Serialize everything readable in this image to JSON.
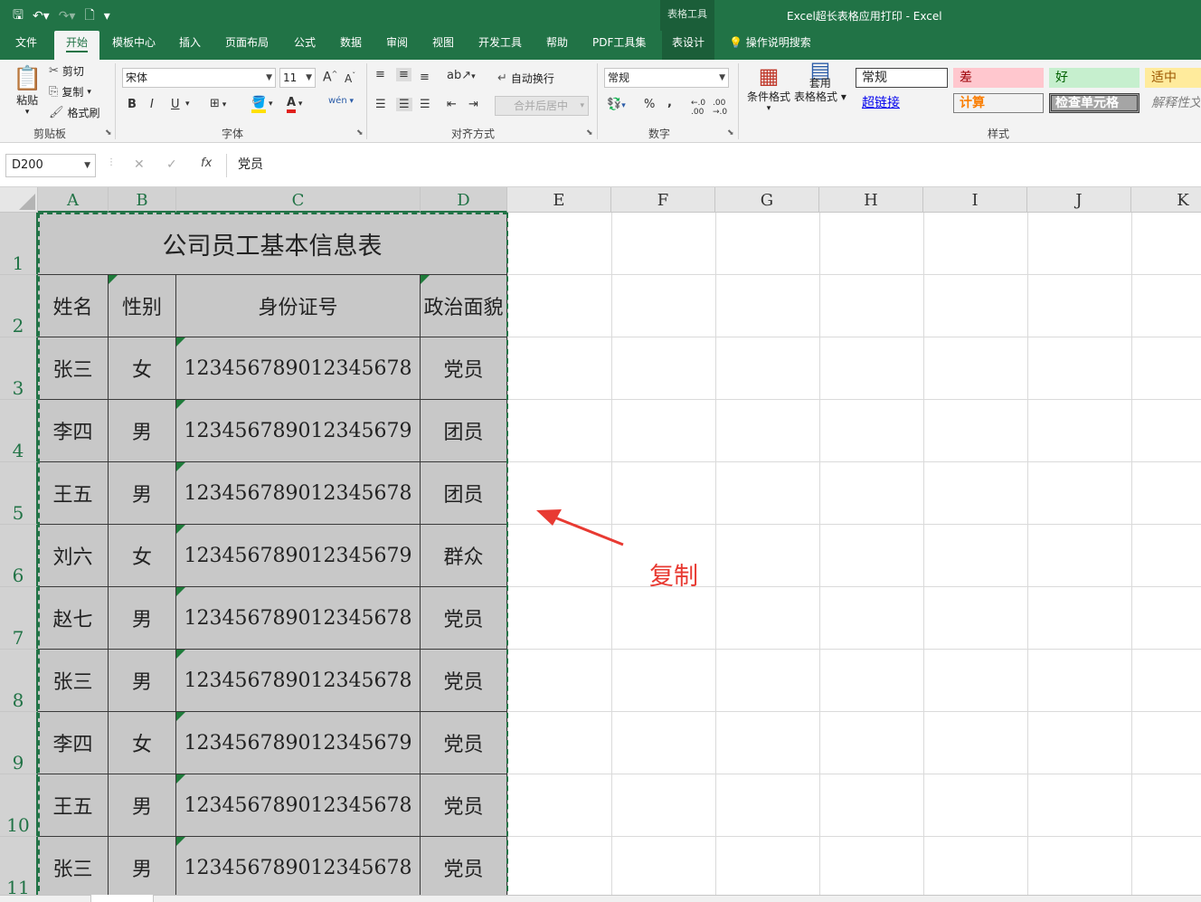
{
  "titlebar": {
    "window_title": "Excel超长表格应用打印  -  Excel",
    "context_group": "表格工具",
    "qat": {
      "save_icon": "save-icon",
      "undo_icon": "undo-icon",
      "redo_icon": "redo-icon",
      "preview_icon": "print-preview-icon",
      "customize": "▾"
    }
  },
  "tabs": [
    "文件",
    "开始",
    "模板中心",
    "插入",
    "页面布局",
    "公式",
    "数据",
    "审阅",
    "视图",
    "开发工具",
    "帮助",
    "PDF工具集",
    "表设计"
  ],
  "active_tab": "开始",
  "tell_me": "操作说明搜索",
  "ribbon": {
    "clipboard": {
      "paste": "粘贴",
      "cut": "剪切",
      "copy": "复制",
      "format_painter": "格式刷",
      "label": "剪贴板"
    },
    "font": {
      "name": "宋体",
      "size": "11",
      "grow": "A",
      "shrink": "A",
      "bold": "B",
      "italic": "I",
      "underline": "U",
      "phonetic": "wén",
      "label": "字体",
      "font_color": "#e0201b",
      "fill_color": "#ffe000"
    },
    "alignment": {
      "wrap": "自动换行",
      "merge": "合并后居中",
      "label": "对齐方式"
    },
    "number": {
      "format": "常规",
      "percent": "%",
      "comma": ",",
      "label": "数字"
    },
    "styles_group": {
      "conditional": "条件格式",
      "table_format_1": "套用",
      "table_format_2": "表格格式",
      "label": "样式"
    },
    "cell_styles": [
      {
        "label": "常规",
        "bg": "#ffffff",
        "color": "#222222",
        "border": "#444444"
      },
      {
        "label": "差",
        "bg": "#ffc7ce",
        "color": "#9c0006",
        "border": "#ffc7ce"
      },
      {
        "label": "好",
        "bg": "#c6efce",
        "color": "#006100",
        "border": "#c6efce"
      },
      {
        "label": "适中",
        "bg": "#ffeb9c",
        "color": "#9c5700",
        "border": "#ffeb9c"
      },
      {
        "label": "超链接",
        "bg": "#f3f3f3",
        "color": "#0000ee",
        "border": "#f3f3f3"
      },
      {
        "label": "计算",
        "bg": "#f2f2f2",
        "color": "#fa7d00",
        "border": "#7f7f7f"
      },
      {
        "label": "检查单元格",
        "bg": "#a5a5a5",
        "color": "#ffffff",
        "border": "#3f3f3f"
      },
      {
        "label": "解释性文本",
        "bg": "#f3f3f3",
        "color": "#7f7f7f",
        "border": "#f3f3f3"
      }
    ]
  },
  "formula_bar": {
    "name_box": "D200",
    "cancel": "✕",
    "enter": "✓",
    "fx": "fx",
    "value": "党员"
  },
  "columns": [
    "A",
    "B",
    "C",
    "D",
    "E",
    "F",
    "G",
    "H",
    "I",
    "J",
    "K"
  ],
  "selected_columns": [
    "A",
    "B",
    "C",
    "D"
  ],
  "rows": [
    "1",
    "2",
    "3",
    "4",
    "5",
    "6",
    "7",
    "8",
    "9",
    "10",
    "11"
  ],
  "sheet": {
    "title": "公司员工基本信息表",
    "headers": [
      "姓名",
      "性别",
      "身份证号",
      "政治面貌"
    ],
    "records": [
      [
        "张三",
        "女",
        "123456789012345678",
        "党员"
      ],
      [
        "李四",
        "男",
        "123456789012345679",
        "团员"
      ],
      [
        "王五",
        "男",
        "123456789012345678",
        "团员"
      ],
      [
        "刘六",
        "女",
        "123456789012345679",
        "群众"
      ],
      [
        "赵七",
        "男",
        "123456789012345678",
        "党员"
      ],
      [
        "张三",
        "男",
        "123456789012345678",
        "党员"
      ],
      [
        "李四",
        "女",
        "123456789012345679",
        "党员"
      ],
      [
        "王五",
        "男",
        "123456789012345678",
        "党员"
      ],
      [
        "张三",
        "男",
        "123456789012345678",
        "党员"
      ]
    ]
  },
  "annotation": {
    "text": "复制",
    "color": "#e83a32"
  }
}
